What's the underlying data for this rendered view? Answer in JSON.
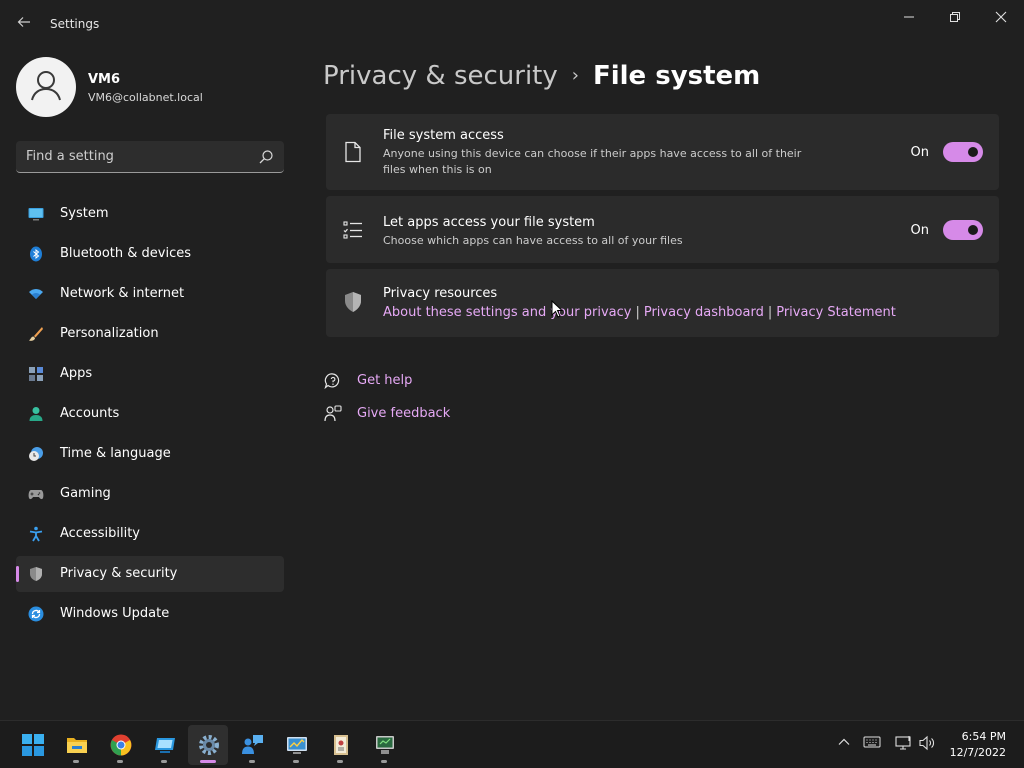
{
  "window": {
    "title": "Settings",
    "controls": {
      "minimize": "—",
      "restore": "❐",
      "close": "✕"
    }
  },
  "user": {
    "name": "VM6",
    "email": "VM6@collabnet.local"
  },
  "search": {
    "placeholder": "Find a setting"
  },
  "sidebar": {
    "items": [
      {
        "label": "System",
        "icon": "monitor-icon"
      },
      {
        "label": "Bluetooth & devices",
        "icon": "bluetooth-icon"
      },
      {
        "label": "Network & internet",
        "icon": "wifi-icon"
      },
      {
        "label": "Personalization",
        "icon": "brush-icon"
      },
      {
        "label": "Apps",
        "icon": "apps-icon"
      },
      {
        "label": "Accounts",
        "icon": "person-icon"
      },
      {
        "label": "Time & language",
        "icon": "clock-globe-icon"
      },
      {
        "label": "Gaming",
        "icon": "gamepad-icon"
      },
      {
        "label": "Accessibility",
        "icon": "accessibility-icon"
      },
      {
        "label": "Privacy & security",
        "icon": "shield-icon",
        "active": true
      },
      {
        "label": "Windows Update",
        "icon": "update-icon"
      }
    ]
  },
  "breadcrumb": {
    "parent": "Privacy & security",
    "separator": "›",
    "current": "File system"
  },
  "cards": {
    "file_system_access": {
      "title": "File system access",
      "description": "Anyone using this device can choose if their apps have access to all of their files when this is on",
      "toggle_label": "On",
      "toggle_on": true
    },
    "apps_access": {
      "title": "Let apps access your file system",
      "description": "Choose which apps can have access to all of your files",
      "toggle_label": "On",
      "toggle_on": true
    },
    "privacy_resources": {
      "title": "Privacy resources",
      "links": [
        "About these settings and your privacy",
        "Privacy dashboard",
        "Privacy Statement"
      ],
      "separator": "|"
    }
  },
  "help": {
    "get_help": "Get help",
    "give_feedback": "Give feedback"
  },
  "taskbar": {
    "apps": [
      "start-icon",
      "file-explorer-icon",
      "chrome-icon",
      "remote-desktop-icon",
      "settings-icon",
      "people-app-icon",
      "network-tool-icon",
      "document-app-icon",
      "computer-management-icon"
    ],
    "clock": {
      "time": "6:54 PM",
      "date": "12/7/2022"
    }
  },
  "colors": {
    "accent": "#d68ae8",
    "link": "#e6a9f5",
    "background": "#202020",
    "card": "#2b2b2b"
  }
}
